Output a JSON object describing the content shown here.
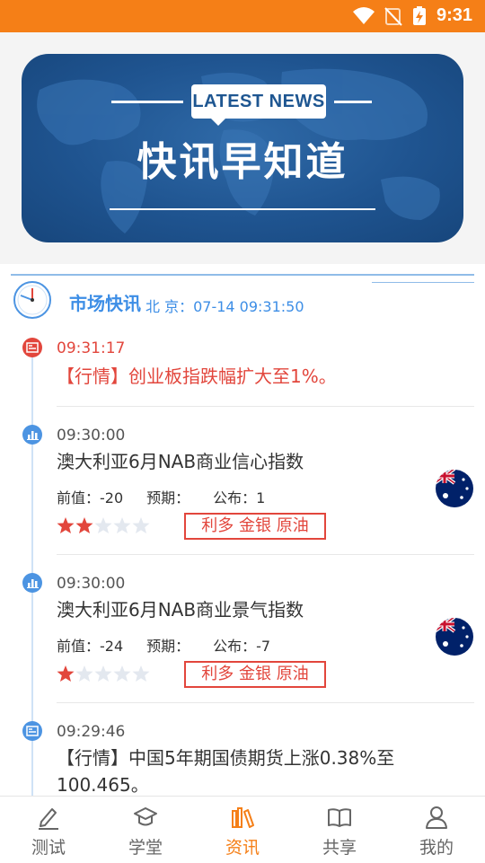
{
  "status_bar": {
    "time": "9:31"
  },
  "banner": {
    "tagline": "LATEST NEWS",
    "headline": "快讯早知道"
  },
  "market": {
    "title": "市场快讯",
    "location_time": "北 京：07-14 09:31:50"
  },
  "news": [
    {
      "time": "09:31:17",
      "text": "【行情】创业板指跌幅扩大至1%。",
      "type": "news",
      "highlight": true
    },
    {
      "time": "09:30:00",
      "text": "澳大利亚6月NAB商业信心指数",
      "type": "data",
      "previous": "前值：-20",
      "forecast": "预期：",
      "actual": "公布：1",
      "stars": 2,
      "impact": "利多 金银 原油",
      "flag": "australia-flag"
    },
    {
      "time": "09:30:00",
      "text": "澳大利亚6月NAB商业景气指数",
      "type": "data",
      "previous": "前值：-24",
      "forecast": "预期：",
      "actual": "公布：-7",
      "stars": 1,
      "impact": "利多 金银 原油",
      "flag": "australia-flag"
    },
    {
      "time": "09:29:46",
      "text": "【行情】中国5年期国债期货上涨0.38%至100.465。",
      "type": "news",
      "highlight": false
    }
  ],
  "nav": [
    {
      "label": "测试",
      "icon": "pencil-icon",
      "active": false
    },
    {
      "label": "学堂",
      "icon": "graduation-cap-icon",
      "active": false
    },
    {
      "label": "资讯",
      "icon": "books-icon",
      "active": true
    },
    {
      "label": "共享",
      "icon": "open-book-icon",
      "active": false
    },
    {
      "label": "我的",
      "icon": "user-icon",
      "active": false
    }
  ],
  "colors": {
    "accent": "#f57f17",
    "red": "#e2463c",
    "blue": "#3d8ee6",
    "banner": "#1f5490"
  }
}
